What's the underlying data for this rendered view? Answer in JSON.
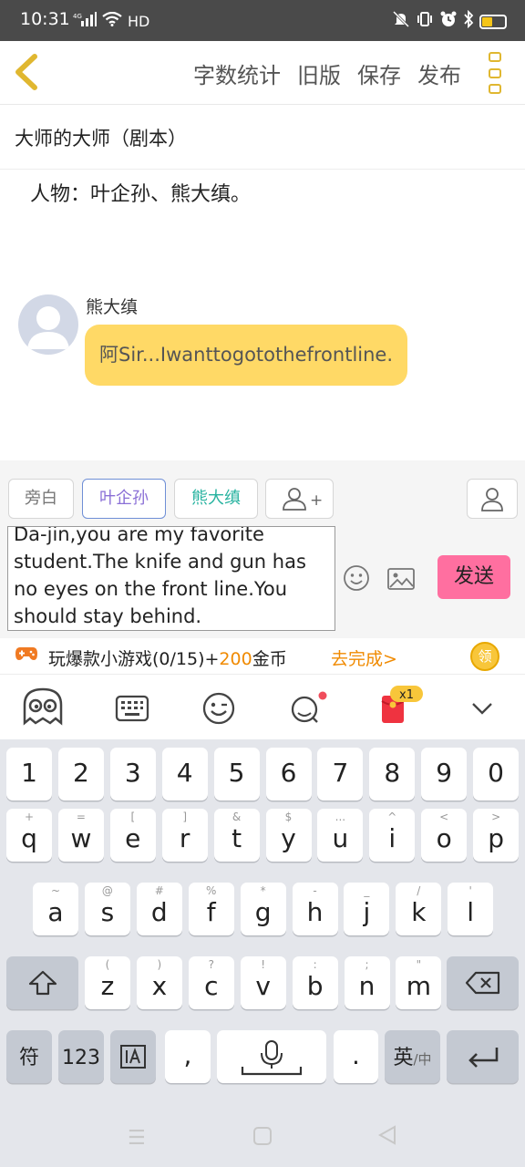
{
  "status_bar": {
    "time": "10:31",
    "signal": "4G",
    "network": "HD",
    "battery_level": 0.45
  },
  "header": {
    "actions": [
      "字数统计",
      "旧版",
      "保存",
      "发布"
    ]
  },
  "document": {
    "title": "大师的大师（剧本）",
    "characters_line": "人物：叶企孙、熊大缜。"
  },
  "message": {
    "sender": "熊大缜",
    "text": "阿Sir...Iwanttogotothefrontline."
  },
  "composer": {
    "roles": [
      "旁白",
      "叶企孙",
      "熊大缜"
    ],
    "add_role_symbol": "+",
    "input_text": "Da-jin,you are my favorite student.The knife and gun has no eyes on the front line.You should stay behind.",
    "send_label": "发送"
  },
  "promo": {
    "text_prefix": "玩爆款小游戏(0/15)+",
    "coins": "200",
    "text_suffix": "金币",
    "link": "去完成>",
    "coin_label": "领"
  },
  "keyboard": {
    "badge": "x1",
    "row1": [
      "1",
      "2",
      "3",
      "4",
      "5",
      "6",
      "7",
      "8",
      "9",
      "0"
    ],
    "row2": [
      {
        "main": "q",
        "sub": "+"
      },
      {
        "main": "w",
        "sub": "="
      },
      {
        "main": "e",
        "sub": "["
      },
      {
        "main": "r",
        "sub": "]"
      },
      {
        "main": "t",
        "sub": "&"
      },
      {
        "main": "y",
        "sub": "$"
      },
      {
        "main": "u",
        "sub": "..."
      },
      {
        "main": "i",
        "sub": "^"
      },
      {
        "main": "o",
        "sub": "<"
      },
      {
        "main": "p",
        "sub": ">"
      }
    ],
    "row3": [
      {
        "main": "a",
        "sub": "~"
      },
      {
        "main": "s",
        "sub": "@"
      },
      {
        "main": "d",
        "sub": "#"
      },
      {
        "main": "f",
        "sub": "%"
      },
      {
        "main": "g",
        "sub": "*"
      },
      {
        "main": "h",
        "sub": "-"
      },
      {
        "main": "j",
        "sub": "_"
      },
      {
        "main": "k",
        "sub": "/"
      },
      {
        "main": "l",
        "sub": "'"
      }
    ],
    "row4": [
      {
        "main": "z",
        "sub": "("
      },
      {
        "main": "x",
        "sub": ")"
      },
      {
        "main": "c",
        "sub": "?"
      },
      {
        "main": "v",
        "sub": "!"
      },
      {
        "main": "b",
        "sub": ":"
      },
      {
        "main": "n",
        "sub": ";"
      },
      {
        "main": "m",
        "sub": "\""
      }
    ],
    "symbol_key": "符",
    "num_key": "123",
    "comma_key": ",",
    "period_key": ".",
    "lang_key": "英",
    "lang_alt": "/中"
  }
}
